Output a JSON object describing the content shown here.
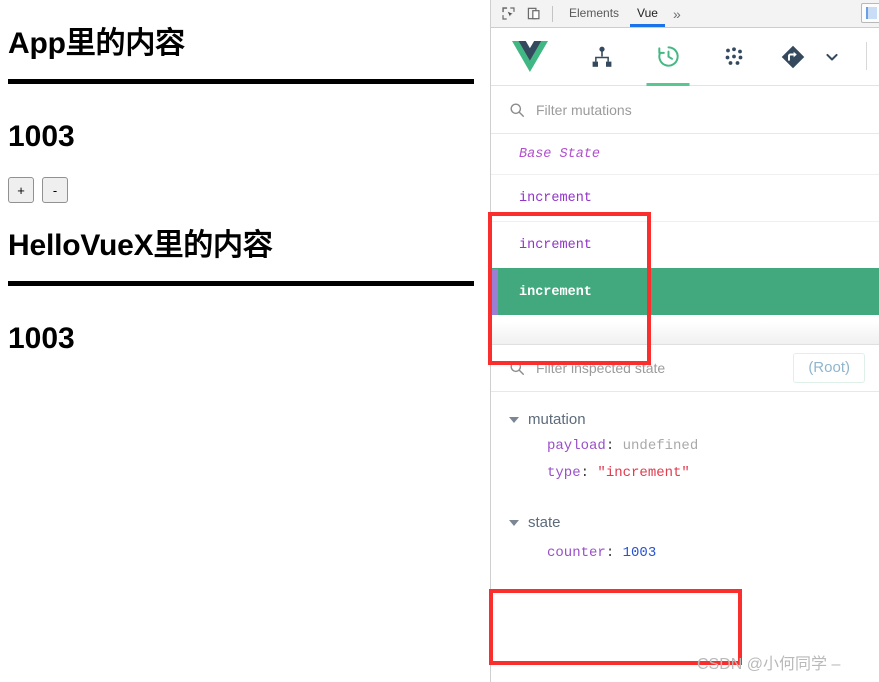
{
  "page": {
    "app_heading": "App里的内容",
    "app_counter": "1003",
    "increment_button": "+",
    "decrement_button": "-",
    "child_heading": "HelloVueX里的内容",
    "child_counter": "1003"
  },
  "devtools": {
    "inspect_icon": "inspect-element-icon",
    "device_icon": "device-toolbar-icon",
    "tabs": [
      {
        "label": "Elements",
        "active": false
      },
      {
        "label": "Vue",
        "active": true
      }
    ],
    "more_tabs": "»",
    "accent_tab_color": "#1a73e8"
  },
  "vue_toolbar": {
    "logo": "vue-logo-icon",
    "buttons": [
      {
        "icon": "component-tree-icon",
        "active": false
      },
      {
        "icon": "history-clock-icon",
        "active": true
      },
      {
        "icon": "vuex-dots-icon",
        "active": false
      },
      {
        "icon": "routing-diamond-icon",
        "active": false
      }
    ],
    "caret": "chevron-down-icon",
    "active_underline_color": "#5ac694"
  },
  "mutations_panel": {
    "filter_placeholder": "Filter mutations",
    "filter_value": "",
    "search_icon": "search-icon",
    "base_state_label": "Base State",
    "entries": [
      {
        "label": "increment",
        "selected": false
      },
      {
        "label": "increment",
        "selected": false
      },
      {
        "label": "increment",
        "selected": true
      }
    ],
    "selected_bg": "#41a97d",
    "selected_bar": "#9b7fd4",
    "mutation_text_color": "#9333c9"
  },
  "inspector_panel": {
    "filter_placeholder": "Filter inspected state",
    "filter_value": "",
    "search_icon": "search-icon",
    "scope_value": "(Root)",
    "groups": [
      {
        "name": "mutation",
        "expanded": true,
        "rows": [
          {
            "key": "payload",
            "value": "undefined",
            "kind": "undefined"
          },
          {
            "key": "type",
            "value": "\"increment\"",
            "kind": "string"
          }
        ]
      },
      {
        "name": "state",
        "expanded": true,
        "rows": [
          {
            "key": "counter",
            "value": "1003",
            "kind": "number"
          }
        ]
      }
    ]
  },
  "annotations": {
    "box_color": "#fb2e2e",
    "mutations_box": "highlight-mutation-list",
    "state_box": "highlight-state-counter"
  },
  "watermark": {
    "text": "CSDN @小何同学 –"
  }
}
